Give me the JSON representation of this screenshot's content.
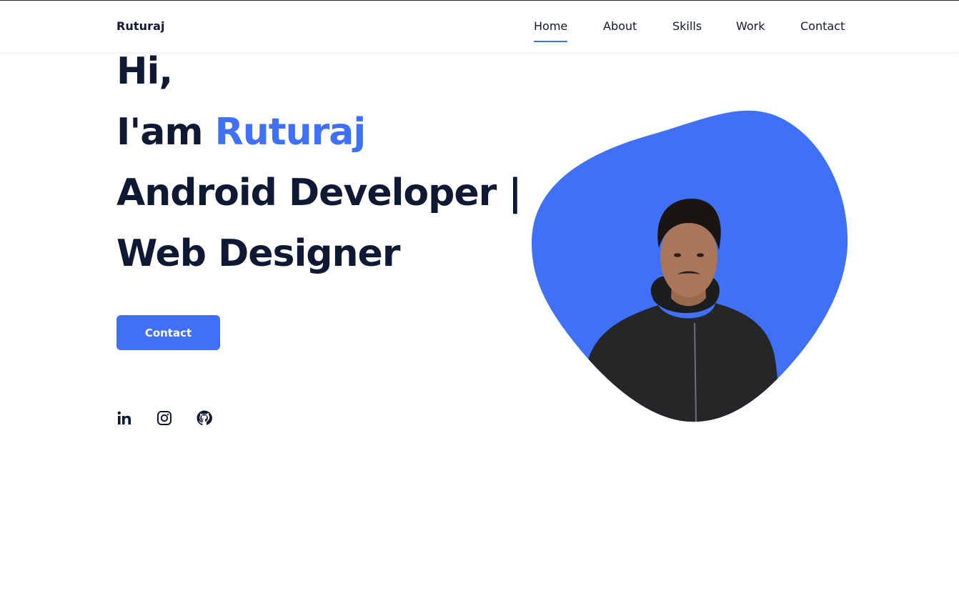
{
  "header": {
    "logo": "Ruturaj",
    "nav": [
      {
        "label": "Home",
        "active": true
      },
      {
        "label": "About",
        "active": false
      },
      {
        "label": "Skills",
        "active": false
      },
      {
        "label": "Work",
        "active": false
      },
      {
        "label": "Contact",
        "active": false
      }
    ]
  },
  "hero": {
    "greeting": "Hi,",
    "intro_prefix": "I'am ",
    "name": "Ruturaj",
    "role_line_1": "Android Developer |",
    "role_line_2": "Web Designer",
    "contact_button": "Contact"
  },
  "social": [
    {
      "name": "linkedin",
      "icon": "linkedin-icon"
    },
    {
      "name": "instagram",
      "icon": "instagram-icon"
    },
    {
      "name": "github",
      "icon": "github-icon"
    }
  ],
  "colors": {
    "accent": "#4070f4",
    "text": "#0e1a33",
    "background": "#ffffff"
  }
}
